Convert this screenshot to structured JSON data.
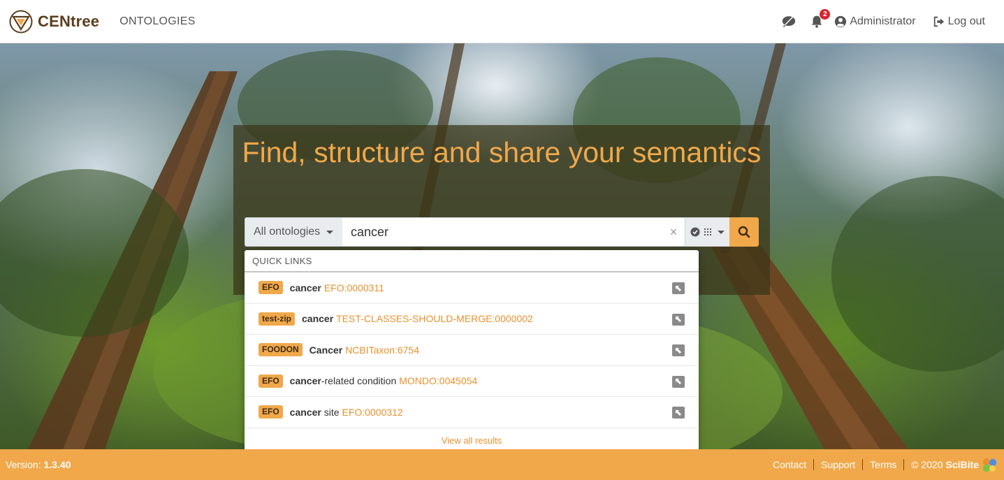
{
  "navbar": {
    "brand": "CENtree",
    "ontologies_link": "ONTOLOGIES",
    "notification_count": "2",
    "user": "Administrator",
    "logout": "Log out",
    "icons": [
      "centree-logo-icon",
      "chat-icon",
      "bell-icon",
      "user-circle-icon",
      "sign-out-icon"
    ]
  },
  "hero": {
    "title": "Find, structure and share your semantics"
  },
  "search": {
    "scope_label": "All ontologies",
    "query": "cancer",
    "clear": "×"
  },
  "quick_links": {
    "header": "QUICK LINKS",
    "items": [
      {
        "tag": "EFO",
        "match": "cancer",
        "rest": "",
        "curie": "EFO:0000311"
      },
      {
        "tag": "test-zip",
        "match": "cancer",
        "rest": "",
        "curie": "TEST-CLASSES-SHOULD-MERGE:0000002"
      },
      {
        "tag": "FOODON",
        "match": "Cancer",
        "rest": "",
        "curie": "NCBITaxon:6754"
      },
      {
        "tag": "EFO",
        "match": "cancer",
        "rest": "-related condition",
        "curie": "MONDO:0045054"
      },
      {
        "tag": "EFO",
        "match": "cancer",
        "rest": " site",
        "curie": "EFO:0000312"
      }
    ],
    "view_all": "View all results"
  },
  "footer": {
    "version_label": "Version: ",
    "version": "1.3.40",
    "links": {
      "contact": "Contact",
      "support": "Support",
      "terms": "Terms"
    },
    "copyright": "© 2020 ",
    "company": "SciBite"
  },
  "colors": {
    "accent": "#f0a84a",
    "link": "#e8912d",
    "brand_text": "#5a3e1c",
    "badge": "#d9232d"
  }
}
